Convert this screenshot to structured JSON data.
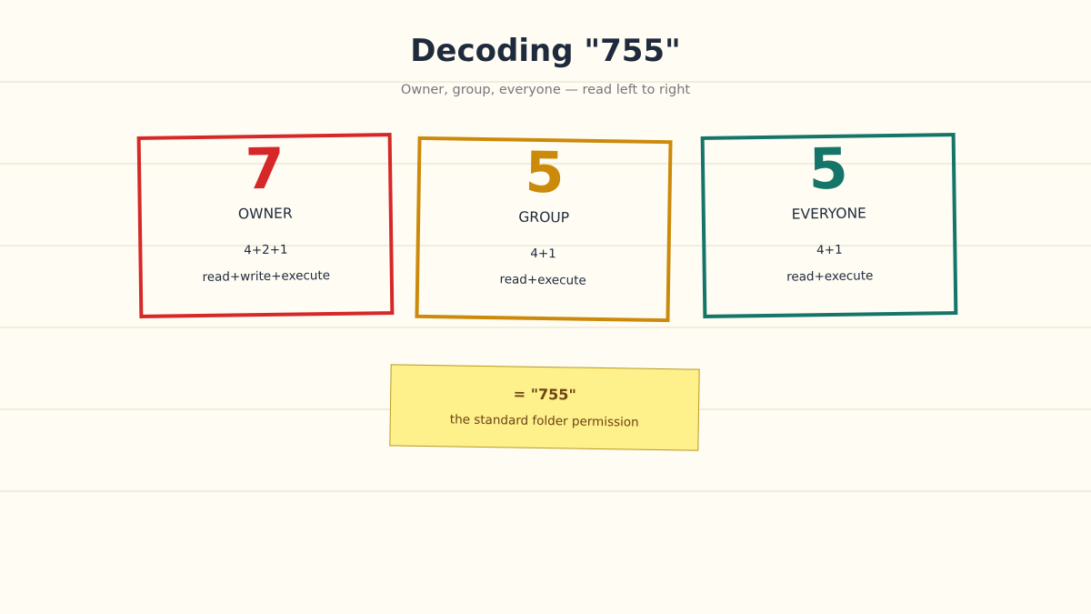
{
  "title": "Decoding \"755\"",
  "subtitle": "Owner, group, everyone — read left to right",
  "cards": [
    {
      "digit": "7",
      "role": "OWNER",
      "sum": "4+2+1",
      "perms": "read+write+execute",
      "color": "#d62828"
    },
    {
      "digit": "5",
      "role": "GROUP",
      "sum": "4+1",
      "perms": "read+execute",
      "color": "#cc8a0b"
    },
    {
      "digit": "5",
      "role": "EVERYONE",
      "sum": "4+1",
      "perms": "read+execute",
      "color": "#157569"
    }
  ],
  "note": {
    "main": "= \"755\"",
    "sub": "the standard folder permission",
    "color": "#fef08a"
  }
}
